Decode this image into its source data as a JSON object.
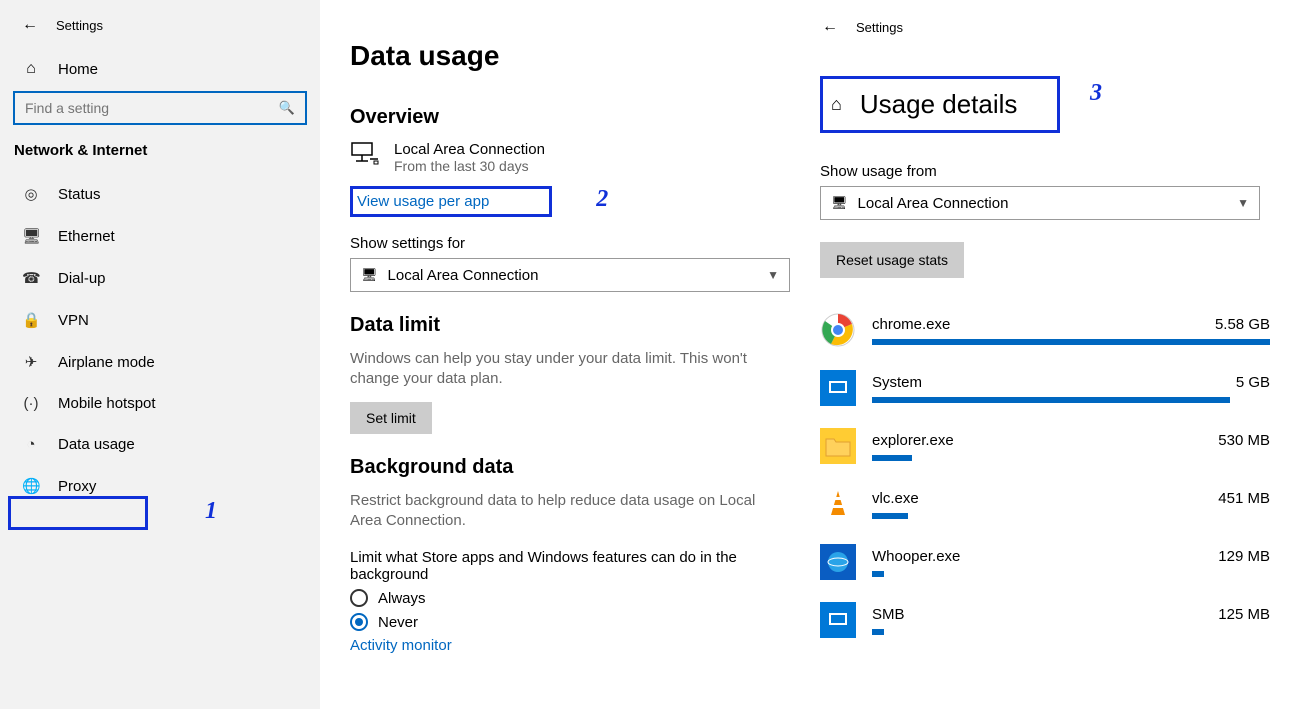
{
  "sidebar": {
    "back_label": "Settings",
    "home_label": "Home",
    "search_placeholder": "Find a setting",
    "category": "Network & Internet",
    "items": [
      {
        "label": "Status"
      },
      {
        "label": "Ethernet"
      },
      {
        "label": "Dial-up"
      },
      {
        "label": "VPN"
      },
      {
        "label": "Airplane mode"
      },
      {
        "label": "Mobile hotspot"
      },
      {
        "label": "Data usage"
      },
      {
        "label": "Proxy"
      }
    ]
  },
  "main": {
    "title": "Data usage",
    "overview_h": "Overview",
    "conn_name": "Local Area Connection",
    "conn_sub": "From the last 30 days",
    "view_link": "View usage per app",
    "show_for": "Show settings for",
    "select_val": "Local Area Connection",
    "limit_h": "Data limit",
    "limit_desc": "Windows can help you stay under your data limit. This won't change your data plan.",
    "set_limit": "Set limit",
    "bg_h": "Background data",
    "bg_desc": "Restrict background data to help reduce data usage on Local Area Connection.",
    "bg_sub": "Limit what Store apps and Windows features can do in the background",
    "opt_always": "Always",
    "opt_never": "Never",
    "activity": "Activity monitor"
  },
  "right": {
    "back_label": "Settings",
    "title": "Usage details",
    "show_from": "Show usage from",
    "select_val": "Local Area Connection",
    "reset": "Reset usage stats",
    "apps": [
      {
        "name": "chrome.exe",
        "size": "5.58 GB",
        "pct": 100
      },
      {
        "name": "System",
        "size": "5 GB",
        "pct": 90
      },
      {
        "name": "explorer.exe",
        "size": "530 MB",
        "pct": 10
      },
      {
        "name": "vlc.exe",
        "size": "451 MB",
        "pct": 9
      },
      {
        "name": "Whooper.exe",
        "size": "129 MB",
        "pct": 3
      },
      {
        "name": "SMB",
        "size": "125 MB",
        "pct": 3
      }
    ]
  },
  "annotations": {
    "n1": "1",
    "n2": "2",
    "n3": "3"
  }
}
